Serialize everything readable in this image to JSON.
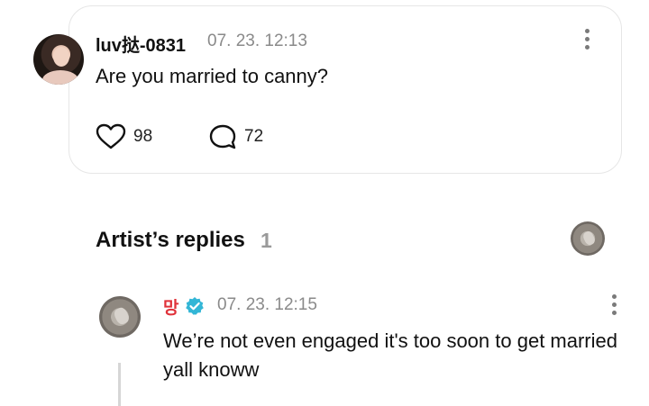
{
  "comment": {
    "author": "luv挞-0831",
    "timestamp": "07. 23. 12:13",
    "text": "Are you married to canny?",
    "likes": "98",
    "replies": "72"
  },
  "artist_replies": {
    "title": "Artist’s replies",
    "count": "1"
  },
  "reply": {
    "author": "망",
    "timestamp": "07. 23. 12:15",
    "text": "We’re not even engaged it's too soon to get married yall knoww",
    "author_color": "#e0323a",
    "verified_color": "#33b6d6"
  },
  "icons": {
    "like": "heart-icon",
    "comment": "speech-bubble-icon",
    "more": "more-vertical-icon",
    "verified": "verified-badge-icon"
  }
}
